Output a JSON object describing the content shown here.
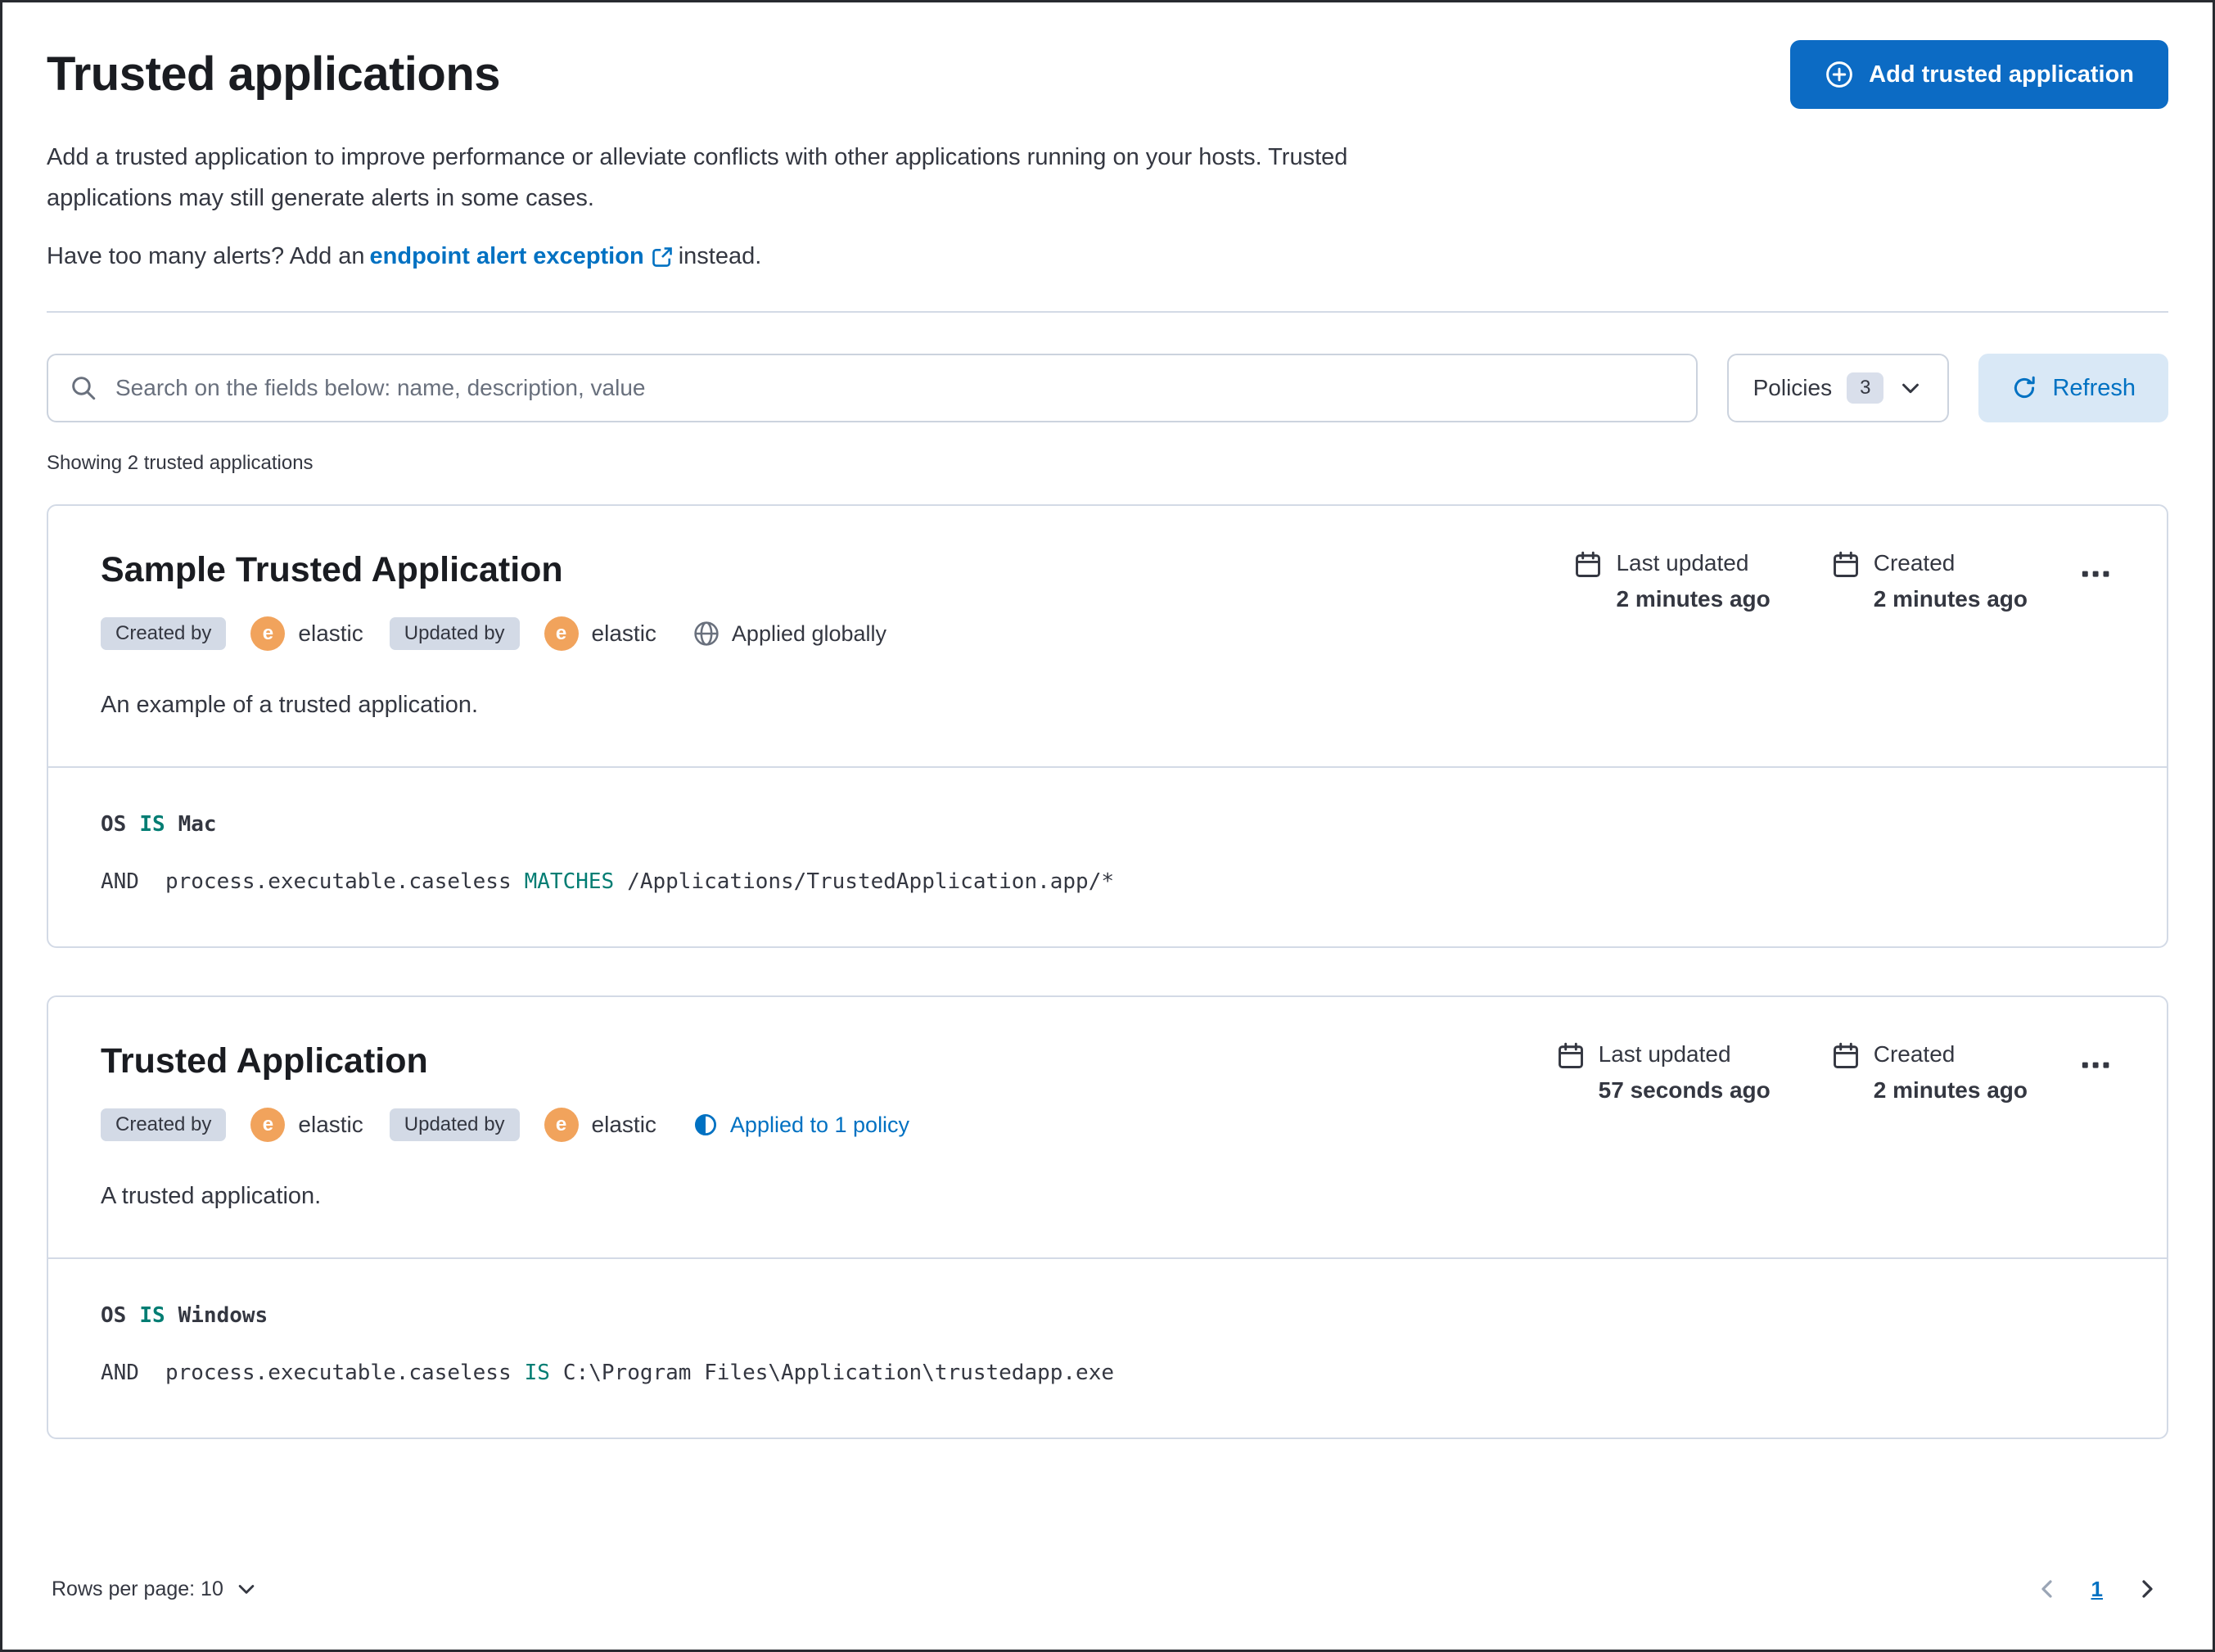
{
  "colors": {
    "primary_button": "#0c6bc4",
    "link": "#0071c2",
    "badge_bg": "#d3dae6",
    "avatar_bg": "#f1a35c",
    "code_keyword": "#017d73",
    "text": "#343741",
    "panel_border": "#d3dae6",
    "refresh_button_bg": "#d9e8f6"
  },
  "header": {
    "title": "Trusted applications",
    "add_button_label": "Add trusted application",
    "description": "Add a trusted application to improve performance or alleviate conflicts with other applications running on your hosts. Trusted applications may still generate alerts in some cases.",
    "alerts_prefix": "Have too many alerts? Add an",
    "alerts_link_label": "endpoint alert exception",
    "alerts_suffix": "instead."
  },
  "toolbar": {
    "search_placeholder": "Search on the fields below: name, description, value",
    "policies_label": "Policies",
    "policies_count": "3",
    "refresh_label": "Refresh"
  },
  "summary_text": "Showing 2 trusted applications",
  "cards": [
    {
      "title": "Sample Trusted Application",
      "avatar_letter": "e",
      "created_by_label": "Created by",
      "created_by_user": "elastic",
      "updated_by_label": "Updated by",
      "updated_by_user": "elastic",
      "scope_label": "Applied globally",
      "last_updated_label": "Last updated",
      "last_updated_value": "2 minutes ago",
      "created_label": "Created",
      "created_value": "2 minutes ago",
      "description": "An example of a trusted application.",
      "code": {
        "line1_field": "OS",
        "line1_operator": "IS",
        "line1_value": "Mac",
        "line2_conjunction": "AND",
        "line2_field": "process.executable.caseless",
        "line2_operator": "MATCHES",
        "line2_value": "/Applications/TrustedApplication.app/*"
      }
    },
    {
      "title": "Trusted Application",
      "avatar_letter": "e",
      "created_by_label": "Created by",
      "created_by_user": "elastic",
      "updated_by_label": "Updated by",
      "updated_by_user": "elastic",
      "scope_label": "Applied to 1 policy",
      "last_updated_label": "Last updated",
      "last_updated_value": "57 seconds ago",
      "created_label": "Created",
      "created_value": "2 minutes ago",
      "description": "A trusted application.",
      "code": {
        "line1_field": "OS",
        "line1_operator": "IS",
        "line1_value": "Windows",
        "line2_conjunction": "AND",
        "line2_field": "process.executable.caseless",
        "line2_operator": "IS",
        "line2_value": "C:\\Program Files\\Application\\trustedapp.exe"
      }
    }
  ],
  "footer": {
    "rows_per_page_label": "Rows per page: 10",
    "current_page": "1"
  }
}
